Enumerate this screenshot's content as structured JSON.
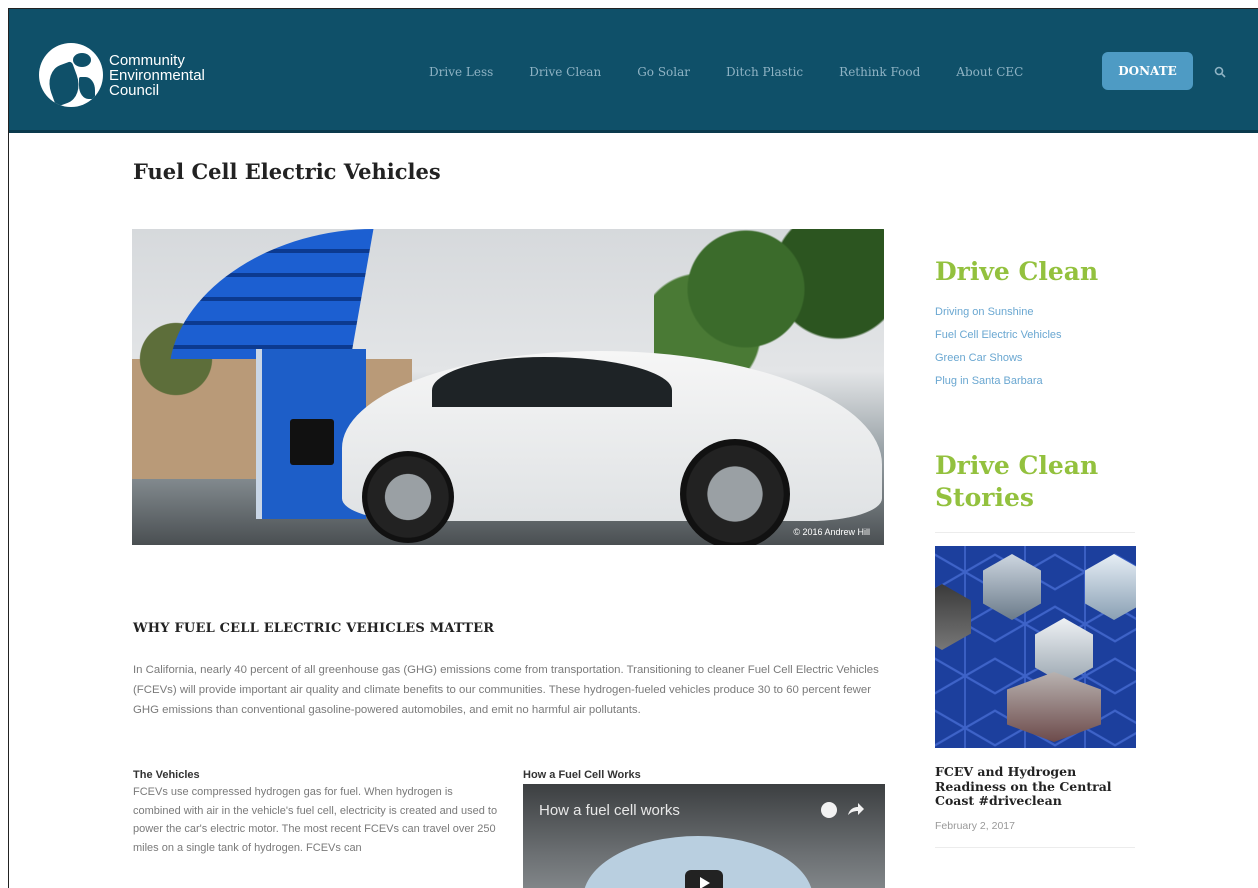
{
  "header": {
    "logo_line1": "Community",
    "logo_line2": "Environmental",
    "logo_line3": "Council",
    "nav": [
      "Drive Less",
      "Drive Clean",
      "Go Solar",
      "Ditch Plastic",
      "Rethink Food",
      "About CEC"
    ],
    "donate_label": "DONATE",
    "icons": {
      "logo": "globe-leaf-icon",
      "search": "search-icon"
    },
    "colors": {
      "bar": "#0f5069",
      "donate": "#4e9bc4"
    }
  },
  "page": {
    "title": "Fuel Cell Electric Vehicles",
    "hero_credit": "© 2016 Andrew Hill",
    "section_heading": "WHY FUEL CELL ELECTRIC VEHICLES MATTER",
    "intro": "In California, nearly 40 percent of all greenhouse gas (GHG) emissions come from transportation. Transitioning to cleaner Fuel Cell Electric Vehicles (FCEVs) will provide important air quality and climate benefits to our communities. These hydrogen-fueled vehicles produce 30 to 60 percent fewer GHG emissions than conventional gasoline-powered automobiles, and emit no harmful air pollutants.",
    "vehicles_heading": "The Vehicles",
    "vehicles_body": "FCEVs use compressed hydrogen gas for fuel. When hydrogen is combined with air in the vehicle's fuel cell, electricity is created and used to power the car's electric motor. The most recent FCEVs can travel over 250 miles on a single tank of hydrogen. FCEVs can",
    "fuelcell_heading": "How a Fuel Cell Works",
    "video_title": "How a fuel cell works"
  },
  "sidebar": {
    "title": "Drive Clean",
    "links": [
      "Driving on Sunshine",
      "Fuel Cell Electric Vehicles",
      "Green Car Shows",
      "Plug in Santa Barbara"
    ],
    "stories_title": "Drive Clean Stories",
    "story": {
      "title": "FCEV and Hydrogen Readiness on the Central Coast #driveclean",
      "date": "February 2, 2017"
    },
    "colors": {
      "accent": "#93c13e",
      "link": "#6aa7d1"
    }
  }
}
